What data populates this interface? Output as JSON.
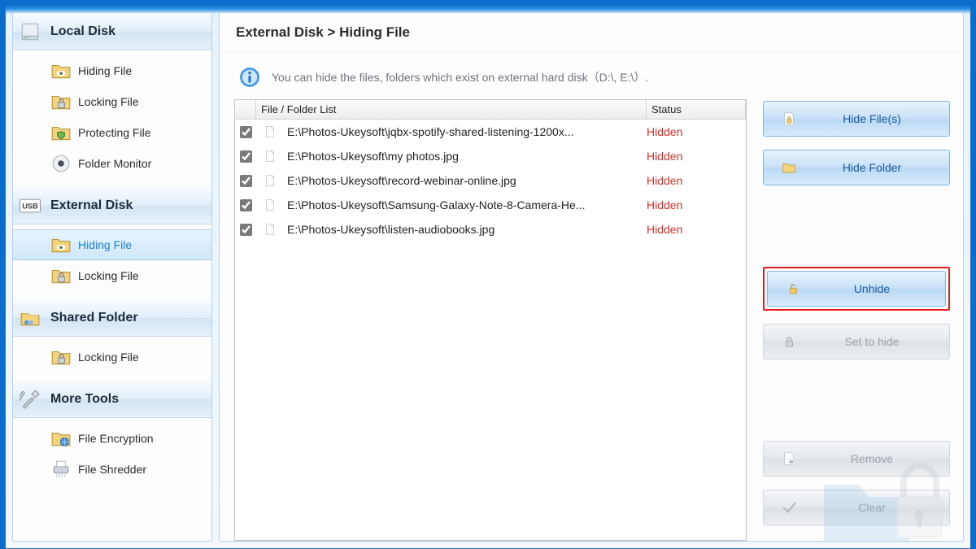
{
  "sidebar": {
    "local_disk": {
      "header": "Local Disk",
      "items": [
        {
          "label": "Hiding File",
          "icon": "folder-eye-icon"
        },
        {
          "label": "Locking File",
          "icon": "folder-lock-icon"
        },
        {
          "label": "Protecting File",
          "icon": "folder-shield-icon"
        },
        {
          "label": "Folder Monitor",
          "icon": "monitor-dot-icon"
        }
      ]
    },
    "external_disk": {
      "header": "External Disk",
      "items": [
        {
          "label": "Hiding File",
          "icon": "folder-eye-icon",
          "selected": true
        },
        {
          "label": "Locking File",
          "icon": "folder-lock-icon"
        }
      ]
    },
    "shared_folder": {
      "header": "Shared Folder",
      "items": [
        {
          "label": "Locking File",
          "icon": "folder-lock-icon"
        }
      ]
    },
    "more_tools": {
      "header": "More Tools",
      "items": [
        {
          "label": "File Encryption",
          "icon": "folder-globe-icon"
        },
        {
          "label": "File Shredder",
          "icon": "shredder-icon"
        }
      ]
    }
  },
  "breadcrumb": "External Disk > Hiding File",
  "banner_text": "You can hide the files, folders which exist on external hard disk（D:\\, E:\\）.",
  "table": {
    "headers": {
      "file": "File / Folder List",
      "status": "Status"
    },
    "rows": [
      {
        "checked": true,
        "path": "E:\\Photos-Ukeysoft\\jqbx-spotify-shared-listening-1200x...",
        "status": "Hidden"
      },
      {
        "checked": true,
        "path": "E:\\Photos-Ukeysoft\\my photos.jpg",
        "status": "Hidden"
      },
      {
        "checked": true,
        "path": "E:\\Photos-Ukeysoft\\record-webinar-online.jpg",
        "status": "Hidden"
      },
      {
        "checked": true,
        "path": "E:\\Photos-Ukeysoft\\Samsung-Galaxy-Note-8-Camera-He...",
        "status": "Hidden"
      },
      {
        "checked": true,
        "path": "E:\\Photos-Ukeysoft\\listen-audiobooks.jpg",
        "status": "Hidden"
      }
    ]
  },
  "actions": {
    "hide_files": "Hide File(s)",
    "hide_folder": "Hide Folder",
    "unhide": "Unhide",
    "set_to_hide": "Set to hide",
    "remove": "Remove",
    "clear": "Clear"
  }
}
